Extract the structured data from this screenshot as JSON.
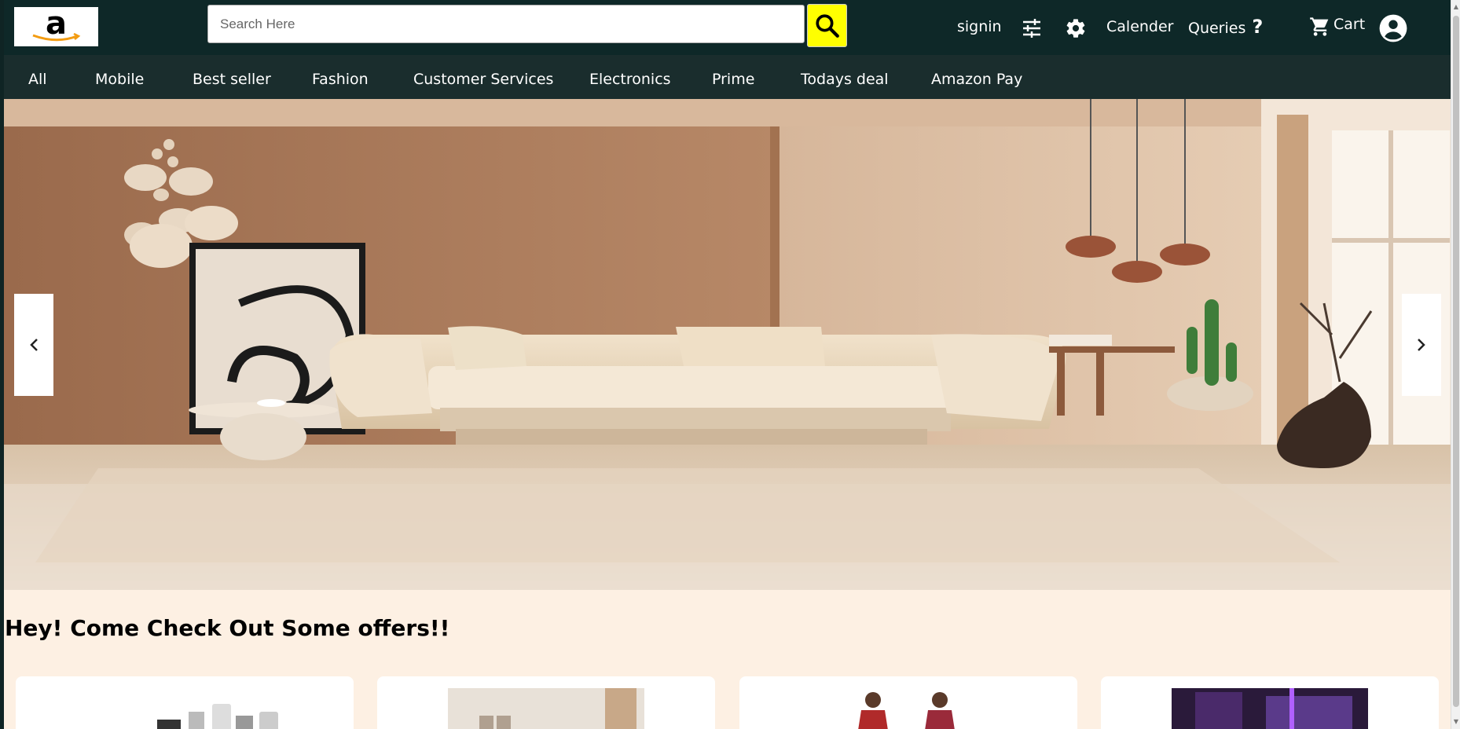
{
  "header": {
    "logo_alt": "a",
    "search": {
      "placeholder": "Search Here",
      "value": ""
    },
    "signin_label": "signin",
    "calendar_label": "Calender",
    "queries_label": "Queries",
    "queries_mark": "?",
    "cart_label": "Cart"
  },
  "categories": [
    "All",
    "Mobile",
    "Best seller",
    "Fashion",
    "Customer Services",
    "Electronics",
    "Prime",
    "Todays deal",
    "Amazon Pay"
  ],
  "hero": {
    "prev_icon": "chevron-left-icon",
    "next_icon": "chevron-right-icon"
  },
  "offers": {
    "title": "Hey! Come Check Out Some offers!!",
    "cards": [
      {
        "image": "electronics-gadgets"
      },
      {
        "image": "home-interior"
      },
      {
        "image": "fashion-sarees"
      },
      {
        "image": "gaming-pc"
      }
    ]
  },
  "colors": {
    "topbar": "#0e2828",
    "catbar": "#1a2d2d",
    "search_button": "#ffff00",
    "page_bg": "#fdf0e3"
  }
}
